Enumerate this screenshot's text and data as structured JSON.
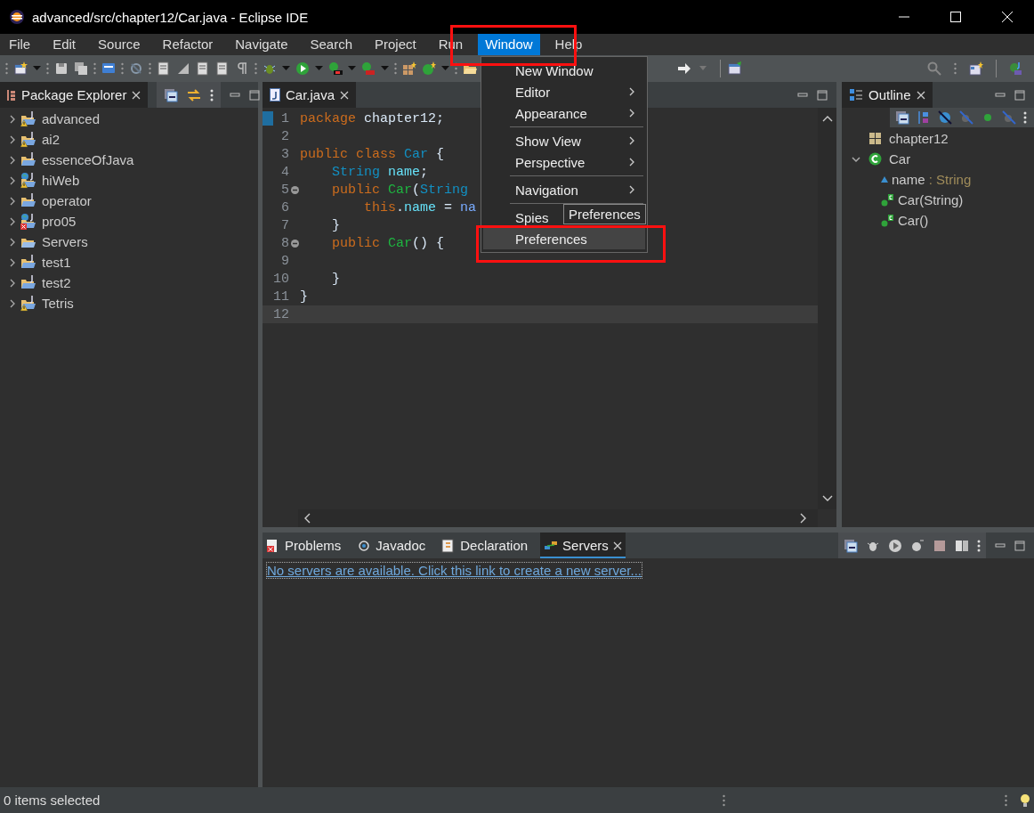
{
  "window": {
    "title": "advanced/src/chapter12/Car.java - Eclipse IDE"
  },
  "menu_bar": [
    {
      "label": "File",
      "selected": false
    },
    {
      "label": "Edit",
      "selected": false
    },
    {
      "label": "Source",
      "selected": false
    },
    {
      "label": "Refactor",
      "selected": false
    },
    {
      "label": "Navigate",
      "selected": false
    },
    {
      "label": "Search",
      "selected": false
    },
    {
      "label": "Project",
      "selected": false
    },
    {
      "label": "Run",
      "selected": false
    },
    {
      "label": "Window",
      "selected": true
    },
    {
      "label": "Help",
      "selected": false
    }
  ],
  "window_menu": {
    "items": [
      {
        "kind": "item",
        "label": "New Window",
        "submenu": false,
        "selected": false
      },
      {
        "kind": "item",
        "label": "Editor",
        "submenu": true,
        "selected": false
      },
      {
        "kind": "item",
        "label": "Appearance",
        "submenu": true,
        "selected": false
      },
      {
        "kind": "separator"
      },
      {
        "kind": "item",
        "label": "Show View",
        "submenu": true,
        "selected": false
      },
      {
        "kind": "item",
        "label": "Perspective",
        "submenu": true,
        "selected": false
      },
      {
        "kind": "separator"
      },
      {
        "kind": "item",
        "label": "Navigation",
        "submenu": true,
        "selected": false
      },
      {
        "kind": "separator"
      },
      {
        "kind": "item",
        "label": "Spies",
        "submenu": false,
        "selected": false
      },
      {
        "kind": "item",
        "label": "Preferences",
        "submenu": false,
        "selected": true
      }
    ],
    "tooltip": "Preferences"
  },
  "package_explorer": {
    "title": "Package Explorer",
    "items": [
      {
        "label": "advanced",
        "kind": "java",
        "warning": true,
        "error": false,
        "expanded": false
      },
      {
        "label": "ai2",
        "kind": "java",
        "warning": true,
        "error": false,
        "expanded": false
      },
      {
        "label": "essenceOfJava",
        "kind": "java",
        "warning": false,
        "error": false,
        "expanded": false
      },
      {
        "label": "hiWeb",
        "kind": "web",
        "warning": true,
        "error": false,
        "expanded": false
      },
      {
        "label": "operator",
        "kind": "java",
        "warning": false,
        "error": false,
        "expanded": false
      },
      {
        "label": "pro05",
        "kind": "web",
        "warning": false,
        "error": true,
        "expanded": false
      },
      {
        "label": "Servers",
        "kind": "folder",
        "warning": false,
        "error": false,
        "expanded": false
      },
      {
        "label": "test1",
        "kind": "java",
        "warning": false,
        "error": false,
        "expanded": false
      },
      {
        "label": "test2",
        "kind": "java",
        "warning": false,
        "error": false,
        "expanded": false
      },
      {
        "label": "Tetris",
        "kind": "java",
        "warning": true,
        "error": false,
        "expanded": false
      }
    ]
  },
  "editor": {
    "tab": {
      "label": "Car.java",
      "selected": true
    },
    "lines": [
      {
        "number": "1",
        "fold": false,
        "current": false,
        "tokens": [
          {
            "kind": "keyword",
            "text": "package"
          },
          {
            "kind": "plain",
            "text": " chapter12;"
          }
        ]
      },
      {
        "number": "2",
        "fold": false,
        "current": false
      },
      {
        "number": "3",
        "fold": false,
        "current": false,
        "tokens": [
          {
            "kind": "keyword",
            "text": "public class"
          },
          {
            "kind": "type",
            "text": " Car"
          },
          {
            "kind": "plain",
            "text": " {"
          }
        ]
      },
      {
        "number": "4",
        "fold": false,
        "current": false,
        "tokens": [
          {
            "kind": "type",
            "text": "    String"
          },
          {
            "kind": "field",
            "text": " name"
          },
          {
            "kind": "plain",
            "text": ";"
          }
        ]
      },
      {
        "number": "5",
        "fold": true,
        "current": false,
        "tokens": [
          {
            "kind": "keyword",
            "text": "    public"
          },
          {
            "kind": "method",
            "text": " Car"
          },
          {
            "kind": "plain",
            "text": "("
          },
          {
            "kind": "type",
            "text": "String"
          }
        ]
      },
      {
        "number": "6",
        "fold": false,
        "current": false,
        "tokens": [
          {
            "kind": "keyword",
            "text": "        this"
          },
          {
            "kind": "plain",
            "text": "."
          },
          {
            "kind": "field",
            "text": "name"
          },
          {
            "kind": "plain",
            "text": " = "
          },
          {
            "kind": "param",
            "text": "na"
          }
        ]
      },
      {
        "number": "7",
        "fold": false,
        "current": false,
        "tokens": [
          {
            "kind": "plain",
            "text": "    }"
          }
        ]
      },
      {
        "number": "8",
        "fold": true,
        "current": false,
        "tokens": [
          {
            "kind": "keyword",
            "text": "    public"
          },
          {
            "kind": "method",
            "text": " Car"
          },
          {
            "kind": "plain",
            "text": "() {"
          }
        ]
      },
      {
        "number": "9",
        "fold": false,
        "current": false
      },
      {
        "number": "10",
        "fold": false,
        "current": false,
        "tokens": [
          {
            "kind": "plain",
            "text": "    }"
          }
        ]
      },
      {
        "number": "11",
        "fold": false,
        "current": false,
        "tokens": [
          {
            "kind": "plain",
            "text": "}"
          }
        ]
      },
      {
        "number": "12",
        "fold": false,
        "current": true
      }
    ]
  },
  "outline": {
    "title": "Outline",
    "items": [
      {
        "label": "chapter12",
        "kind": "package"
      },
      {
        "label": "Car",
        "kind": "class",
        "expanded": true,
        "children": [
          {
            "label": "name",
            "detail": " : String",
            "kind": "field"
          },
          {
            "label": "Car(String)",
            "kind": "constructor"
          },
          {
            "label": "Car()",
            "kind": "constructor"
          }
        ]
      }
    ]
  },
  "bottom_panel": {
    "tabs": [
      {
        "label": "Problems",
        "kind": "problems",
        "selected": false
      },
      {
        "label": "Javadoc",
        "kind": "javadoc",
        "selected": false
      },
      {
        "label": "Declaration",
        "kind": "declaration",
        "selected": false
      },
      {
        "label": "Servers",
        "kind": "servers",
        "selected": true
      }
    ],
    "link": "No servers are available. Click this link to create a new server..."
  },
  "status_bar": {
    "text": "0 items selected"
  }
}
